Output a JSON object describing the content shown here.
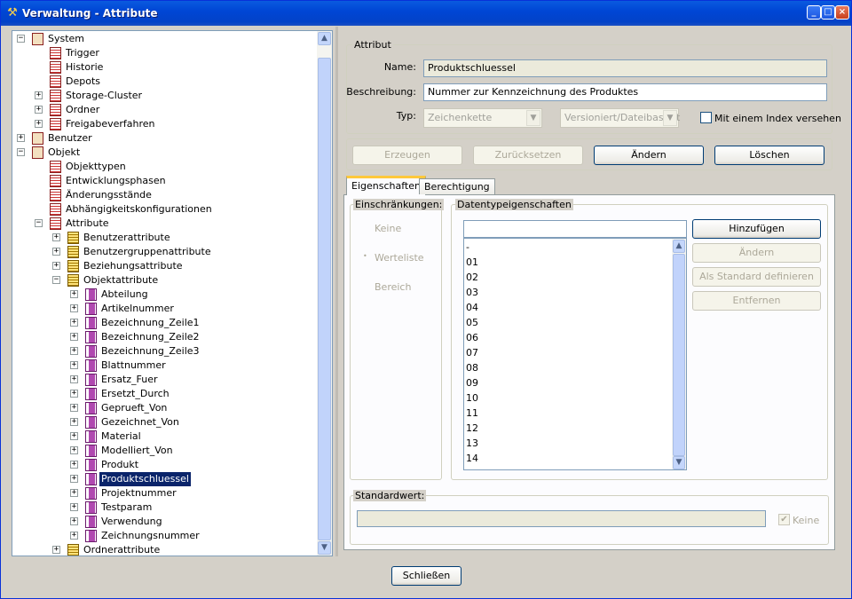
{
  "window": {
    "title": "Verwaltung - Attribute",
    "app_icon": "tools-icon"
  },
  "tree": {
    "rows": [
      {
        "label": "System",
        "level": 0,
        "exp": "minus",
        "icon": "sys"
      },
      {
        "label": "Trigger",
        "level": 1,
        "exp": "",
        "icon": "page"
      },
      {
        "label": "Historie",
        "level": 1,
        "exp": "",
        "icon": "page"
      },
      {
        "label": "Depots",
        "level": 1,
        "exp": "",
        "icon": "page"
      },
      {
        "label": "Storage-Cluster",
        "level": 1,
        "exp": "plus",
        "icon": "page"
      },
      {
        "label": "Ordner",
        "level": 1,
        "exp": "plus",
        "icon": "page"
      },
      {
        "label": "Freigabeverfahren",
        "level": 1,
        "exp": "plus",
        "icon": "page"
      },
      {
        "label": "Benutzer",
        "level": 0,
        "exp": "plus",
        "icon": "sys"
      },
      {
        "label": "Objekt",
        "level": 0,
        "exp": "minus",
        "icon": "sys"
      },
      {
        "label": "Objekttypen",
        "level": 1,
        "exp": "",
        "icon": "page"
      },
      {
        "label": "Entwicklungsphasen",
        "level": 1,
        "exp": "",
        "icon": "page"
      },
      {
        "label": "Änderungsstände",
        "level": 1,
        "exp": "",
        "icon": "page"
      },
      {
        "label": "Abhängigkeitskonfigurationen",
        "level": 1,
        "exp": "",
        "icon": "page"
      },
      {
        "label": "Attribute",
        "level": 1,
        "exp": "minus",
        "icon": "page"
      },
      {
        "label": "Benutzerattribute",
        "level": 2,
        "exp": "plus",
        "icon": "folder"
      },
      {
        "label": "Benutzergruppenattribute",
        "level": 2,
        "exp": "plus",
        "icon": "folder"
      },
      {
        "label": "Beziehungsattribute",
        "level": 2,
        "exp": "plus",
        "icon": "folder"
      },
      {
        "label": "Objektattribute",
        "level": 2,
        "exp": "minus",
        "icon": "folder"
      },
      {
        "label": "Abteilung",
        "level": 3,
        "exp": "plus",
        "icon": "attr"
      },
      {
        "label": "Artikelnummer",
        "level": 3,
        "exp": "plus",
        "icon": "attr"
      },
      {
        "label": "Bezeichnung_Zeile1",
        "level": 3,
        "exp": "plus",
        "icon": "attr"
      },
      {
        "label": "Bezeichnung_Zeile2",
        "level": 3,
        "exp": "plus",
        "icon": "attr"
      },
      {
        "label": "Bezeichnung_Zeile3",
        "level": 3,
        "exp": "plus",
        "icon": "attr"
      },
      {
        "label": "Blattnummer",
        "level": 3,
        "exp": "plus",
        "icon": "attr"
      },
      {
        "label": "Ersatz_Fuer",
        "level": 3,
        "exp": "plus",
        "icon": "attr"
      },
      {
        "label": "Ersetzt_Durch",
        "level": 3,
        "exp": "plus",
        "icon": "attr"
      },
      {
        "label": "Geprueft_Von",
        "level": 3,
        "exp": "plus",
        "icon": "attr"
      },
      {
        "label": "Gezeichnet_Von",
        "level": 3,
        "exp": "plus",
        "icon": "attr"
      },
      {
        "label": "Material",
        "level": 3,
        "exp": "plus",
        "icon": "attr"
      },
      {
        "label": "Modelliert_Von",
        "level": 3,
        "exp": "plus",
        "icon": "attr"
      },
      {
        "label": "Produkt",
        "level": 3,
        "exp": "plus",
        "icon": "attr"
      },
      {
        "label": "Produktschluessel",
        "level": 3,
        "exp": "plus",
        "icon": "attr",
        "selected": true
      },
      {
        "label": "Projektnummer",
        "level": 3,
        "exp": "plus",
        "icon": "attr"
      },
      {
        "label": "Testparam",
        "level": 3,
        "exp": "plus",
        "icon": "attr"
      },
      {
        "label": "Verwendung",
        "level": 3,
        "exp": "plus",
        "icon": "attr"
      },
      {
        "label": "Zeichnungsnummer",
        "level": 3,
        "exp": "plus",
        "icon": "attr"
      },
      {
        "label": "Ordnerattribute",
        "level": 2,
        "exp": "plus",
        "icon": "folder"
      }
    ]
  },
  "attribut": {
    "legend": "Attribut",
    "name_label": "Name:",
    "name_value": "Produktschluessel",
    "desc_label": "Beschreibung:",
    "desc_value": "Nummer zur Kennzeichnung des Produktes",
    "typ_label": "Typ:",
    "typ_value": "Zeichenkette",
    "version_value": "Versioniert/Dateibasiert",
    "index_label": "Mit einem Index versehen"
  },
  "actions": {
    "create": "Erzeugen",
    "reset": "Zurücksetzen",
    "change": "Ändern",
    "delete": "Löschen"
  },
  "tabs": [
    {
      "label": "Eigenschaften"
    },
    {
      "label": "Berechtigung"
    }
  ],
  "restrictions": {
    "legend": "Einschränkungen:",
    "options": [
      "Keine",
      "Werteliste",
      "Bereich"
    ],
    "selected": "Werteliste"
  },
  "datatype": {
    "legend": "Datentypeigenschaften",
    "input_value": "",
    "values": [
      "-",
      "01",
      "02",
      "03",
      "04",
      "05",
      "06",
      "07",
      "08",
      "09",
      "10",
      "11",
      "12",
      "13",
      "14"
    ],
    "add": "Hinzufügen",
    "change": "Ändern",
    "set_default": "Als Standard definieren",
    "remove": "Entfernen"
  },
  "default": {
    "legend": "Standardwert:",
    "value": "",
    "none_label": "Keine",
    "none_checked": true
  },
  "close_label": "Schließen"
}
